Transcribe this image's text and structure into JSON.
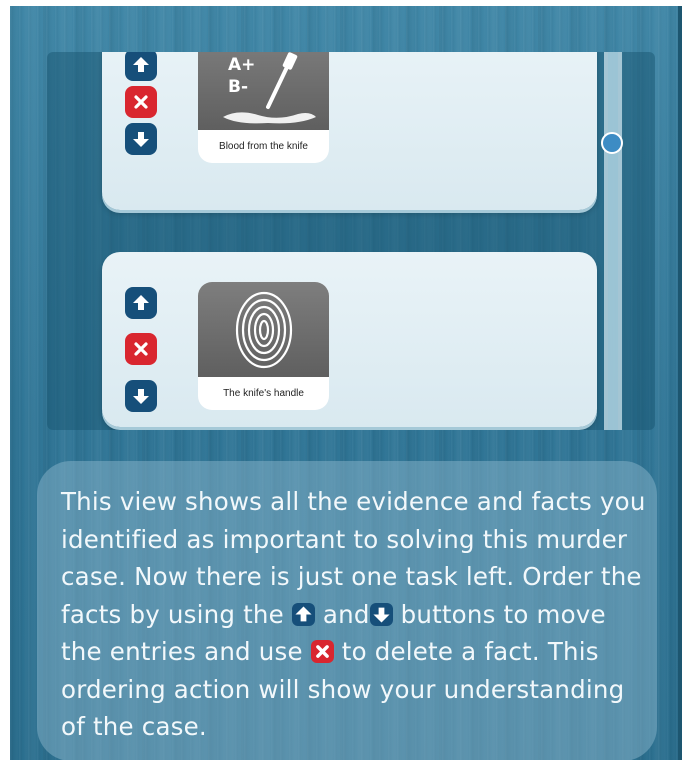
{
  "evidence_list": {
    "items": [
      {
        "label": "Blood from the knife",
        "icon": "blood-type-knife-icon",
        "art_text": [
          "A+",
          "B-"
        ]
      },
      {
        "label": "The knife's handle",
        "icon": "fingerprint-icon"
      }
    ],
    "controls": {
      "move_up_icon": "arrow-up-icon",
      "delete_icon": "close-x-icon",
      "move_down_icon": "arrow-down-icon"
    }
  },
  "instructions": {
    "part1": "This view shows all the evidence and facts you identified as important to solving this murder case. Now there is just one task left. Order the facts by using the",
    "part2": "and",
    "part3": "buttons to move the entries and use",
    "part4": "to delete a fact. This ordering action will show your understanding of the case."
  },
  "colors": {
    "background": "#2f7596",
    "move_button": "#164f7a",
    "delete_button": "#d9262f",
    "card": "#e3eff4",
    "scroll_thumb": "#3d8cc4"
  }
}
